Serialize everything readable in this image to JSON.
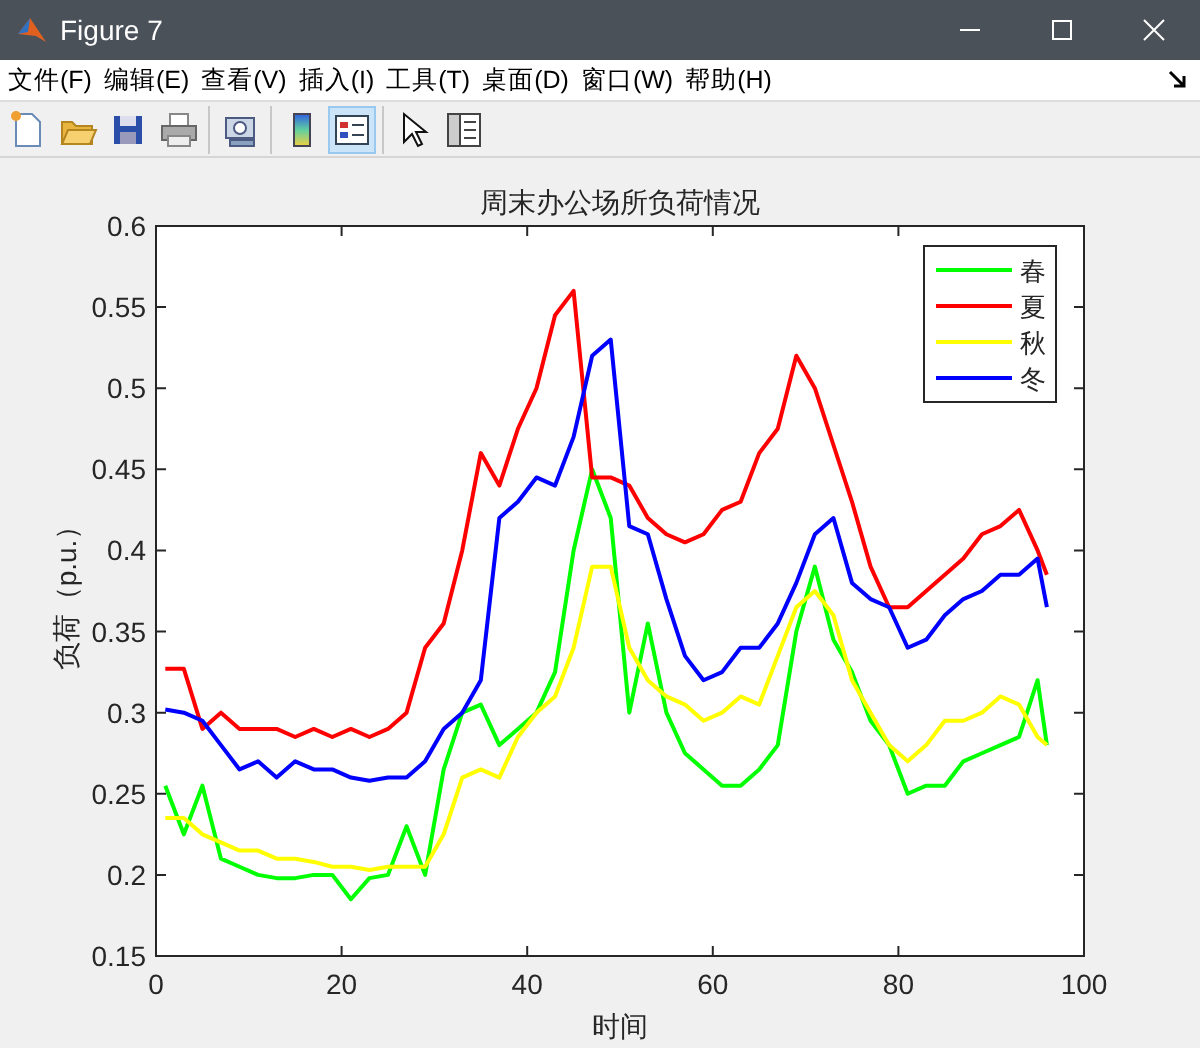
{
  "window": {
    "title": "Figure 7"
  },
  "menu": [
    "文件(F)",
    "编辑(E)",
    "查看(V)",
    "插入(I)",
    "工具(T)",
    "桌面(D)",
    "窗口(W)",
    "帮助(H)"
  ],
  "toolbar": [
    [
      {
        "kind": "new",
        "selected": false
      },
      {
        "kind": "open",
        "selected": false
      },
      {
        "kind": "save",
        "selected": false
      },
      {
        "kind": "print",
        "selected": false
      }
    ],
    [
      {
        "kind": "link",
        "selected": false
      }
    ],
    [
      {
        "kind": "colorbar",
        "selected": false
      },
      {
        "kind": "legend",
        "selected": true
      }
    ],
    [
      {
        "kind": "pointer",
        "selected": false
      },
      {
        "kind": "property",
        "selected": false
      }
    ]
  ],
  "figure": {
    "chart_data": {
      "type": "line",
      "title": "周末办公场所负荷情况",
      "xlabel": "时间",
      "ylabel": "负荷（p.u.）",
      "x": [
        1,
        3,
        5,
        7,
        9,
        11,
        13,
        15,
        17,
        19,
        21,
        23,
        25,
        27,
        29,
        31,
        33,
        35,
        37,
        39,
        41,
        43,
        45,
        47,
        49,
        51,
        53,
        55,
        57,
        59,
        61,
        63,
        65,
        67,
        69,
        71,
        73,
        75,
        77,
        79,
        81,
        83,
        85,
        87,
        89,
        91,
        93,
        95,
        96
      ],
      "series": [
        {
          "name": "春",
          "color": "#00ff00",
          "values": [
            0.255,
            0.225,
            0.255,
            0.21,
            0.205,
            0.2,
            0.198,
            0.198,
            0.2,
            0.2,
            0.185,
            0.198,
            0.2,
            0.23,
            0.2,
            0.265,
            0.3,
            0.305,
            0.28,
            0.29,
            0.3,
            0.325,
            0.4,
            0.45,
            0.42,
            0.3,
            0.355,
            0.3,
            0.275,
            0.265,
            0.255,
            0.255,
            0.265,
            0.28,
            0.35,
            0.39,
            0.345,
            0.325,
            0.295,
            0.28,
            0.25,
            0.255,
            0.255,
            0.27,
            0.275,
            0.28,
            0.285,
            0.32,
            0.28
          ]
        },
        {
          "name": "夏",
          "color": "#ff0000",
          "values": [
            0.327,
            0.327,
            0.29,
            0.3,
            0.29,
            0.29,
            0.29,
            0.285,
            0.29,
            0.285,
            0.29,
            0.285,
            0.29,
            0.3,
            0.34,
            0.355,
            0.4,
            0.46,
            0.44,
            0.475,
            0.5,
            0.545,
            0.56,
            0.445,
            0.445,
            0.44,
            0.42,
            0.41,
            0.405,
            0.41,
            0.425,
            0.43,
            0.46,
            0.475,
            0.52,
            0.5,
            0.465,
            0.43,
            0.39,
            0.365,
            0.365,
            0.375,
            0.385,
            0.395,
            0.41,
            0.415,
            0.425,
            0.4,
            0.385
          ]
        },
        {
          "name": "秋",
          "color": "#ffff00",
          "values": [
            0.235,
            0.235,
            0.225,
            0.22,
            0.215,
            0.215,
            0.21,
            0.21,
            0.208,
            0.205,
            0.205,
            0.203,
            0.205,
            0.205,
            0.205,
            0.225,
            0.26,
            0.265,
            0.26,
            0.285,
            0.3,
            0.31,
            0.34,
            0.39,
            0.39,
            0.34,
            0.32,
            0.31,
            0.305,
            0.295,
            0.3,
            0.31,
            0.305,
            0.335,
            0.365,
            0.375,
            0.36,
            0.32,
            0.3,
            0.28,
            0.27,
            0.28,
            0.295,
            0.295,
            0.3,
            0.31,
            0.305,
            0.285,
            0.28
          ]
        },
        {
          "name": "冬",
          "color": "#0000ff",
          "values": [
            0.302,
            0.3,
            0.295,
            0.28,
            0.265,
            0.27,
            0.26,
            0.27,
            0.265,
            0.265,
            0.26,
            0.258,
            0.26,
            0.26,
            0.27,
            0.29,
            0.3,
            0.32,
            0.42,
            0.43,
            0.445,
            0.44,
            0.47,
            0.52,
            0.53,
            0.415,
            0.41,
            0.37,
            0.335,
            0.32,
            0.325,
            0.34,
            0.34,
            0.355,
            0.38,
            0.41,
            0.42,
            0.38,
            0.37,
            0.365,
            0.34,
            0.345,
            0.36,
            0.37,
            0.375,
            0.385,
            0.385,
            0.395,
            0.365
          ]
        }
      ],
      "legend": true,
      "xlim": [
        0,
        100
      ],
      "ylim": [
        0.15,
        0.6
      ],
      "xticks": [
        0,
        20,
        40,
        60,
        80,
        100
      ],
      "yticks": [
        0.15,
        0.2,
        0.25,
        0.3,
        0.35,
        0.4,
        0.45,
        0.5,
        0.55,
        0.6
      ]
    }
  }
}
